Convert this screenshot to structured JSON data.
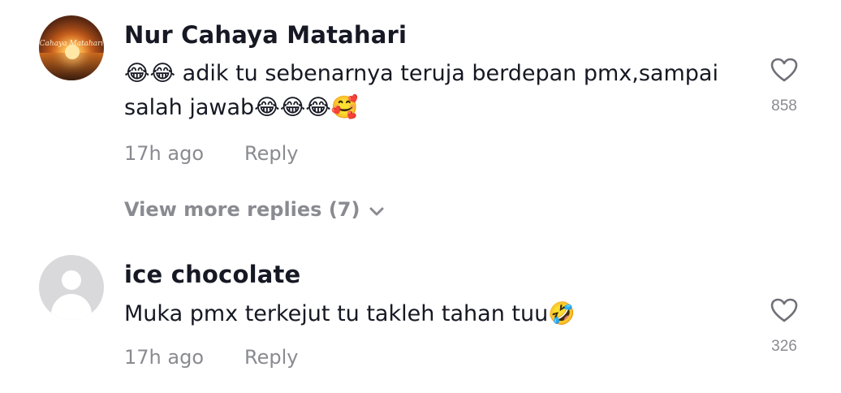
{
  "comments": [
    {
      "username": "Nur Cahaya Matahari",
      "avatar_caption": "Cahaya Matahari",
      "text": "😂😂 adik tu sebenarnya teruja berdepan pmx,sampai salah jawab😂😂😂🥰",
      "time": "17h ago",
      "reply_label": "Reply",
      "likes": "858"
    },
    {
      "username": "ice chocolate",
      "text": "Muka pmx terkejut tu takleh tahan tuu🤣",
      "time": "17h ago",
      "reply_label": "Reply",
      "likes": "326"
    }
  ],
  "view_more_label": "View more replies (7)",
  "colors": {
    "primary_text": "#161823",
    "secondary_text": "#8a8b91"
  }
}
